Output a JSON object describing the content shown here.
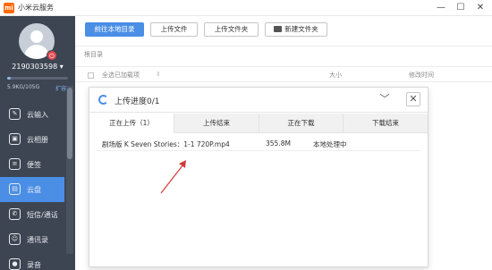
{
  "window": {
    "title": "小米云服务",
    "logo_text": "mi",
    "minimize": "—",
    "maximize": "☐",
    "close": "✕"
  },
  "sidebar": {
    "account": "2190303598 ▾",
    "storage_text": "5.9KG/105G",
    "storage_ratio": 0.06,
    "expand_label": "扩容",
    "items": [
      {
        "label": "云输入",
        "icon": "cloud-input-icon",
        "glyph": "✎"
      },
      {
        "label": "云相册",
        "icon": "album-icon",
        "glyph": "▣"
      },
      {
        "label": "便签",
        "icon": "note-icon",
        "glyph": "≡"
      },
      {
        "label": "云盘",
        "icon": "cloud-drive-icon",
        "glyph": "▤",
        "active": true
      },
      {
        "label": "短信/通话",
        "icon": "sms-icon",
        "glyph": "✆"
      },
      {
        "label": "通讯录",
        "icon": "contacts-icon",
        "glyph": "☺"
      },
      {
        "label": "录音",
        "icon": "recording-icon",
        "glyph": "●"
      }
    ]
  },
  "toolbar": {
    "local_dir": "前往本地目录",
    "upload_file": "上传文件",
    "upload_folder": "上传文件夹",
    "new_folder": "新建文件夹"
  },
  "breadcrumb": "根目录",
  "list_header": {
    "select_all": "全选已加载项",
    "size": "大小",
    "modified": "修改时间"
  },
  "upload_panel": {
    "title": "上传进度0/1",
    "collapse_glyph": "﹀",
    "close_glyph": "✕",
    "tabs": [
      "正在上传（1）",
      "上传结束",
      "正在下载",
      "下载结束"
    ],
    "rows": [
      {
        "name": "剧场版 K Seven Stories：1-1 720P.mp4",
        "size": "355.8M",
        "status": "本地处理中"
      }
    ]
  },
  "colors": {
    "accent": "#4a8ee6",
    "sidebar_bg": "#3d4552",
    "arrow": "#d23b3b"
  }
}
